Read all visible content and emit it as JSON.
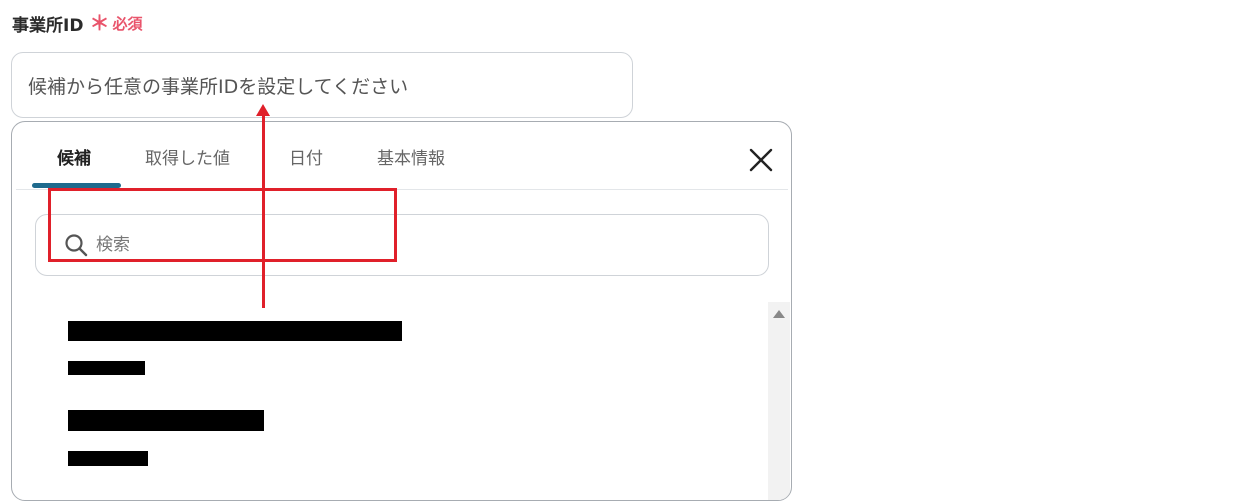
{
  "field": {
    "label": "事業所ID",
    "required_star": "＊",
    "required_text": "必須",
    "placeholder": "候補から任意の事業所IDを設定してください"
  },
  "tabs": [
    {
      "label": "候補",
      "active": true
    },
    {
      "label": "取得した値",
      "active": false
    },
    {
      "label": "日付",
      "active": false
    },
    {
      "label": "基本情報",
      "active": false
    }
  ],
  "search": {
    "placeholder": "検索",
    "icon": "search-icon"
  },
  "close_icon": "close-icon",
  "candidates": [
    {
      "title": "",
      "id": "",
      "redacted": true
    },
    {
      "title": "",
      "id": "",
      "redacted": true
    }
  ],
  "colors": {
    "required": "#e9546b",
    "tab_accent": "#1e6a8d",
    "annotation": "#e0202a"
  }
}
